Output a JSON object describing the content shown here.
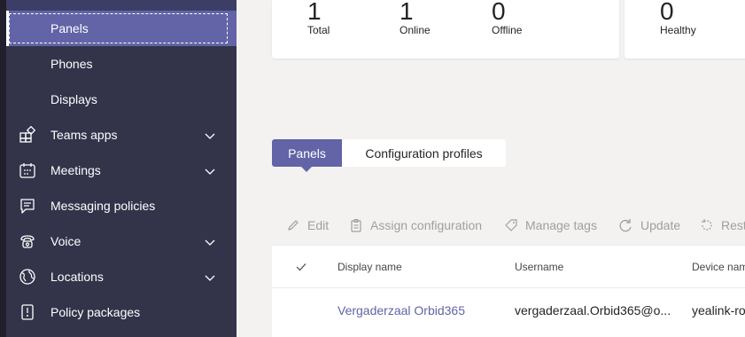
{
  "sidebar": {
    "items": [
      {
        "label": "Panels",
        "active": true,
        "icon": "none"
      },
      {
        "label": "Phones",
        "icon": "none"
      },
      {
        "label": "Displays",
        "icon": "none"
      },
      {
        "label": "Teams apps",
        "icon": "apps-icon",
        "expandable": true
      },
      {
        "label": "Meetings",
        "icon": "calendar-icon",
        "expandable": true
      },
      {
        "label": "Messaging policies",
        "icon": "chat-icon"
      },
      {
        "label": "Voice",
        "icon": "phone-icon",
        "expandable": true
      },
      {
        "label": "Locations",
        "icon": "globe-icon",
        "expandable": true
      },
      {
        "label": "Policy packages",
        "icon": "package-icon"
      }
    ]
  },
  "stats": {
    "card1": [
      {
        "value": "1",
        "label": "Total"
      },
      {
        "value": "1",
        "label": "Online"
      },
      {
        "value": "0",
        "label": "Offline"
      }
    ],
    "card2": [
      {
        "value": "0",
        "label": "Healthy"
      }
    ]
  },
  "tabs": [
    {
      "label": "Panels",
      "active": true
    },
    {
      "label": "Configuration profiles",
      "active": false
    }
  ],
  "toolbar": {
    "edit": "Edit",
    "assign": "Assign configuration",
    "tags": "Manage tags",
    "update": "Update",
    "restart": "Rest"
  },
  "table": {
    "columns": [
      "Display name",
      "Username",
      "Device nam"
    ],
    "rows": [
      {
        "display_name": "Vergaderzaal Orbid365",
        "username": "vergaderzaal.Orbid365@o...",
        "device": "yealink-ro"
      }
    ]
  },
  "colors": {
    "accent": "#6264a7",
    "sidebar_bg": "#33344a",
    "disabled": "#a19f9d"
  }
}
